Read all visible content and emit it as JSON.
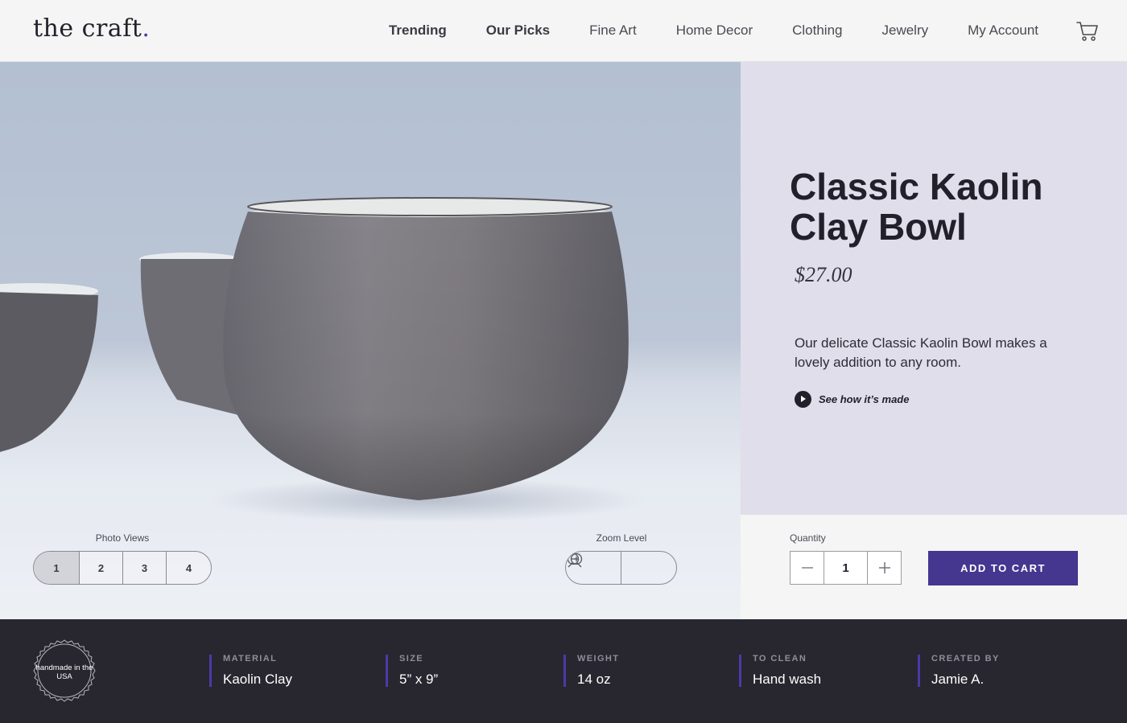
{
  "brand": {
    "name": "the craft",
    "dot": ".",
    "accent": "#4b3aa8"
  },
  "nav": {
    "items": [
      {
        "label": "Trending",
        "bold": true
      },
      {
        "label": "Our Picks",
        "bold": true
      },
      {
        "label": "Fine Art",
        "bold": false
      },
      {
        "label": "Home Decor",
        "bold": false
      },
      {
        "label": "Clothing",
        "bold": false
      },
      {
        "label": "Jewelry",
        "bold": false
      },
      {
        "label": "My Account",
        "bold": false
      }
    ],
    "cart_icon": "cart-icon"
  },
  "gallery": {
    "photo_views_label": "Photo Views",
    "photo_views": [
      "1",
      "2",
      "3",
      "4"
    ],
    "active_view": "1",
    "zoom_label": "Zoom Level",
    "zoom_out_icon": "zoom-out-icon",
    "zoom_in_icon": "zoom-in-icon"
  },
  "product": {
    "title": "Classic Kaolin Clay Bowl",
    "price": "$27.00",
    "description": "Our delicate Classic Kaolin Bowl makes a lovely addition to any room.",
    "how_made_label": "See how it’s made"
  },
  "purchase": {
    "quantity_label": "Quantity",
    "quantity": "1",
    "add_to_cart_label": "ADD TO CART",
    "button_color": "#45368f"
  },
  "footer": {
    "seal_text": "handmade in the USA",
    "specs": [
      {
        "key": "MATERIAL",
        "value": "Kaolin Clay"
      },
      {
        "key": "SIZE",
        "value": "5” x 9”"
      },
      {
        "key": "WEIGHT",
        "value": "14 oz"
      },
      {
        "key": "TO CLEAN",
        "value": "Hand wash"
      },
      {
        "key": "CREATED BY",
        "value": "Jamie A."
      }
    ]
  }
}
